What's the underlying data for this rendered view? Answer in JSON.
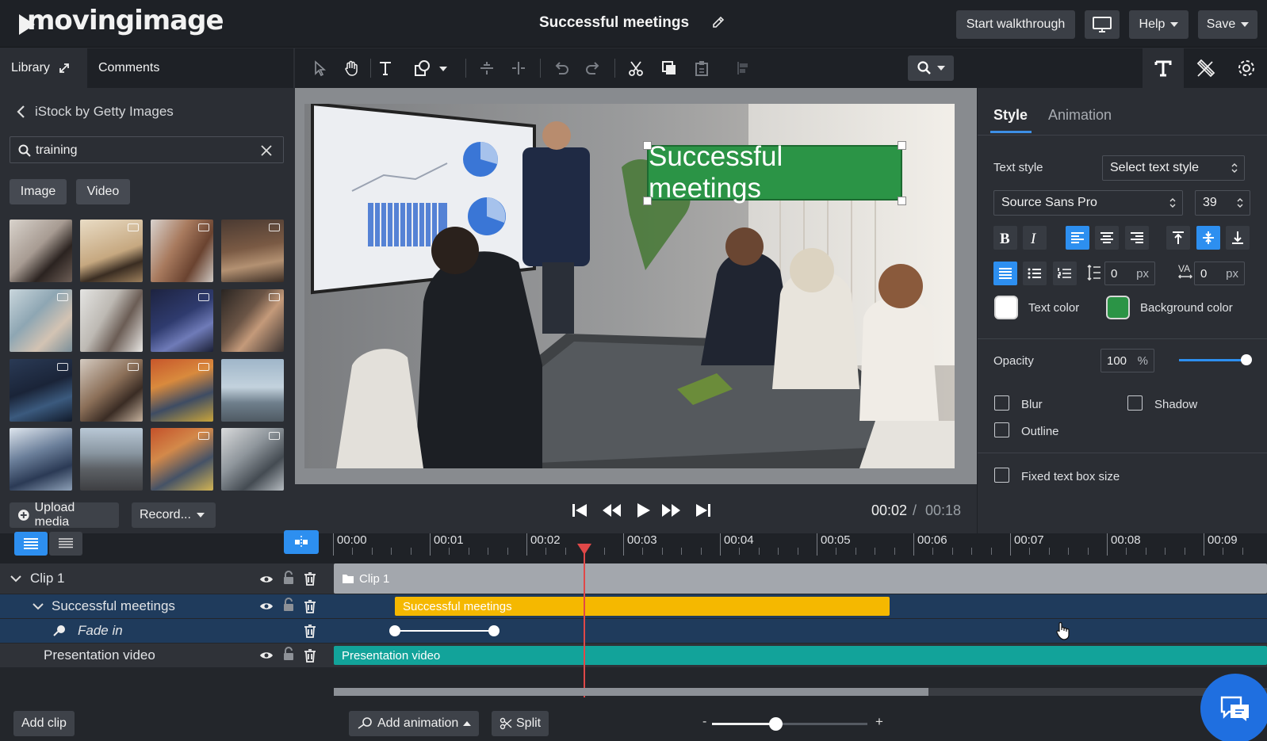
{
  "app": {
    "logo": "movingimage",
    "title": "Successful meetings"
  },
  "topbar": {
    "walkthrough_label": "Start walkthrough",
    "help_label": "Help",
    "save_label": "Save"
  },
  "left_panel": {
    "tabs": [
      {
        "label": "Library"
      },
      {
        "label": "Comments"
      }
    ],
    "source": "iStock by Getty Images",
    "search": {
      "value": "training",
      "placeholder": ""
    },
    "filters": [
      {
        "label": "Image"
      },
      {
        "label": "Video"
      }
    ],
    "upload_label": "Upload media",
    "record_label": "Record..."
  },
  "stage": {
    "text_overlay": "Successful meetings"
  },
  "player": {
    "current_time": "00:02",
    "separator": "/",
    "total_time": "00:18"
  },
  "right_panel": {
    "tabs": [
      {
        "label": "Style"
      },
      {
        "label": "Animation"
      }
    ],
    "text_style_label": "Text style",
    "text_style_value": "Select text style",
    "font_family": "Source Sans Pro",
    "font_size": "39",
    "line_spacing_value": "0",
    "letter_spacing_value": "0",
    "unit_px": "px",
    "text_color_label": "Text color",
    "background_color_label": "Background color",
    "colors": {
      "text": "#ffffff",
      "background": "#2b9446",
      "accent": "#2d8ff0"
    },
    "opacity_label": "Opacity",
    "opacity_value": "100",
    "opacity_unit": "%",
    "opacity_fraction": 1.0,
    "blur_label": "Blur",
    "shadow_label": "Shadow",
    "outline_label": "Outline",
    "fixed_box_label": "Fixed text box size"
  },
  "timeline": {
    "ticks": [
      "00:00",
      "00:01",
      "00:02",
      "00:03",
      "00:04",
      "00:05",
      "00:06",
      "00:07",
      "00:08",
      "00:09"
    ],
    "rows": [
      {
        "label": "Clip 1",
        "bar_label": "Clip 1"
      },
      {
        "label": "Successful meetings",
        "bar_label": "Successful meetings"
      },
      {
        "label": "Fade in"
      },
      {
        "label": "Presentation video",
        "bar_label": "Presentation video"
      }
    ],
    "add_clip_label": "Add clip",
    "add_animation_label": "Add animation",
    "split_label": "Split",
    "zoom_minus": "-",
    "zoom_plus": "+"
  }
}
